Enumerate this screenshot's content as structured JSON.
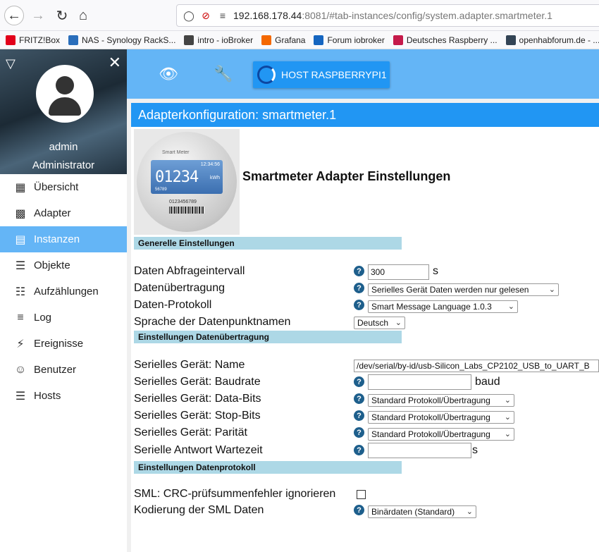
{
  "browser": {
    "url_host": "192.168.178.44",
    "url_rest": ":8081/#tab-instances/config/system.adapter.smartmeter.1",
    "bookmarks": [
      {
        "label": "FRITZ!Box",
        "color": "#e2001a"
      },
      {
        "label": "NAS - Synology RackS...",
        "color": "#2a6ebb"
      },
      {
        "label": "intro - ioBroker",
        "color": "#444444"
      },
      {
        "label": "Grafana",
        "color": "#f46800"
      },
      {
        "label": "Forum iobroker",
        "color": "#1565c0"
      },
      {
        "label": "Deutsches Raspberry ...",
        "color": "#c51a4a"
      },
      {
        "label": "openhabforum.de - ...",
        "color": "#345"
      }
    ]
  },
  "sidebar": {
    "user_name": "admin",
    "user_role": "Administrator",
    "items": [
      {
        "label": "Übersicht",
        "icon": "grid-icon"
      },
      {
        "label": "Adapter",
        "icon": "store-icon"
      },
      {
        "label": "Instanzen",
        "icon": "instances-icon",
        "active": true
      },
      {
        "label": "Objekte",
        "icon": "list-icon"
      },
      {
        "label": "Aufzählungen",
        "icon": "enum-icon"
      },
      {
        "label": "Log",
        "icon": "log-icon"
      },
      {
        "label": "Ereignisse",
        "icon": "bolt-icon"
      },
      {
        "label": "Benutzer",
        "icon": "user-icon"
      },
      {
        "label": "Hosts",
        "icon": "hosts-icon"
      }
    ]
  },
  "topbar": {
    "host_label": "HOST RASPBERRYPI1"
  },
  "panel": {
    "title": "Adapterkonfiguration: smartmeter.1",
    "heading": "Smartmeter Adapter Einstellungen",
    "logo": {
      "brand": "Smart Meter",
      "digits": "01234",
      "time": "12:34:56",
      "unit": "kWh",
      "sub": "56789",
      "serial": "0123456789"
    },
    "sections": {
      "general": "Generelle Einstellungen",
      "transfer": "Einstellungen Datenübertragung",
      "protocol": "Einstellungen Datenprotokoll"
    },
    "fields": {
      "interval_label": "Daten Abfrageintervall",
      "interval_value": "300",
      "interval_unit": "s",
      "transfer_label": "Datenübertragung",
      "transfer_value": "Serielles Gerät Daten werden nur gelesen",
      "protocol_label": "Daten-Protokoll",
      "protocol_value": "Smart Message Language 1.0.3",
      "language_label": "Sprache der Datenpunktnamen",
      "language_value": "Deutsch",
      "device_label": "Serielles Gerät: Name",
      "device_value": "/dev/serial/by-id/usb-Silicon_Labs_CP2102_USB_to_UART_B",
      "baud_label": "Serielles Gerät: Baudrate",
      "baud_value": "",
      "baud_unit": "baud",
      "databits_label": "Serielles Gerät: Data-Bits",
      "databits_value": "Standard Protokoll/Übertragung",
      "stopbits_label": "Serielles Gerät: Stop-Bits",
      "stopbits_value": "Standard Protokoll/Übertragung",
      "parity_label": "Serielles Gerät: Parität",
      "parity_value": "Standard Protokoll/Übertragung",
      "wait_label": "Serielle Antwort Wartezeit",
      "wait_value": "",
      "wait_unit": "s",
      "crc_label": "SML: CRC-prüfsummenfehler ignorieren",
      "encoding_label": "Kodierung der SML Daten",
      "encoding_value": "Binärdaten (Standard)"
    }
  }
}
